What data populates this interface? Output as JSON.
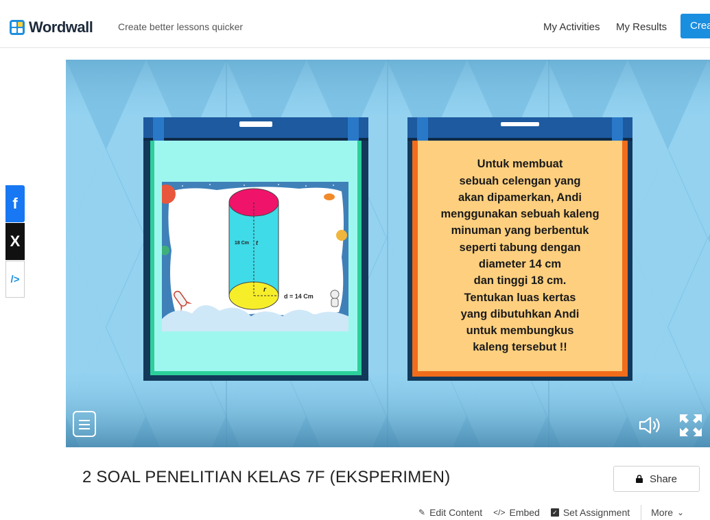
{
  "header": {
    "logo_text": "Wordwall",
    "tagline": "Create better lessons quicker",
    "nav": [
      "My Activities",
      "My Results"
    ],
    "create_label": "Crea"
  },
  "sidebar": {
    "facebook_glyph": "f",
    "x_glyph": "X",
    "embed_glyph": "/>"
  },
  "game": {
    "picture": {
      "height_label": "18 Cm",
      "height_var": "t",
      "radius_var": "r",
      "diameter_label": "d = 14 Cm"
    },
    "question_lines": [
      "Untuk membuat",
      "sebuah celengan yang",
      "akan dipamerkan, Andi",
      "menggunakan sebuah kaleng",
      "minuman yang berbentuk",
      "seperti tabung dengan",
      "diameter 14 cm",
      "dan tinggi 18 cm.",
      "Tentukan luas kertas",
      "yang dibutuhkan Andi",
      "untuk membungkus",
      "kaleng tersebut !!"
    ]
  },
  "activity": {
    "title": "2 SOAL PENELITIAN KELAS 7F (EKSPERIMEN)",
    "share_label": "Share",
    "actions": {
      "edit": "Edit Content",
      "embed": "Embed",
      "assignment": "Set Assignment",
      "more": "More"
    }
  },
  "colors": {
    "brand_blue": "#1a8fe0",
    "stage_bg": "#7fc3e6",
    "left_card_face": "#9ef7ee",
    "right_card_face": "#fecf7e",
    "right_card_border": "#f26d1b"
  }
}
